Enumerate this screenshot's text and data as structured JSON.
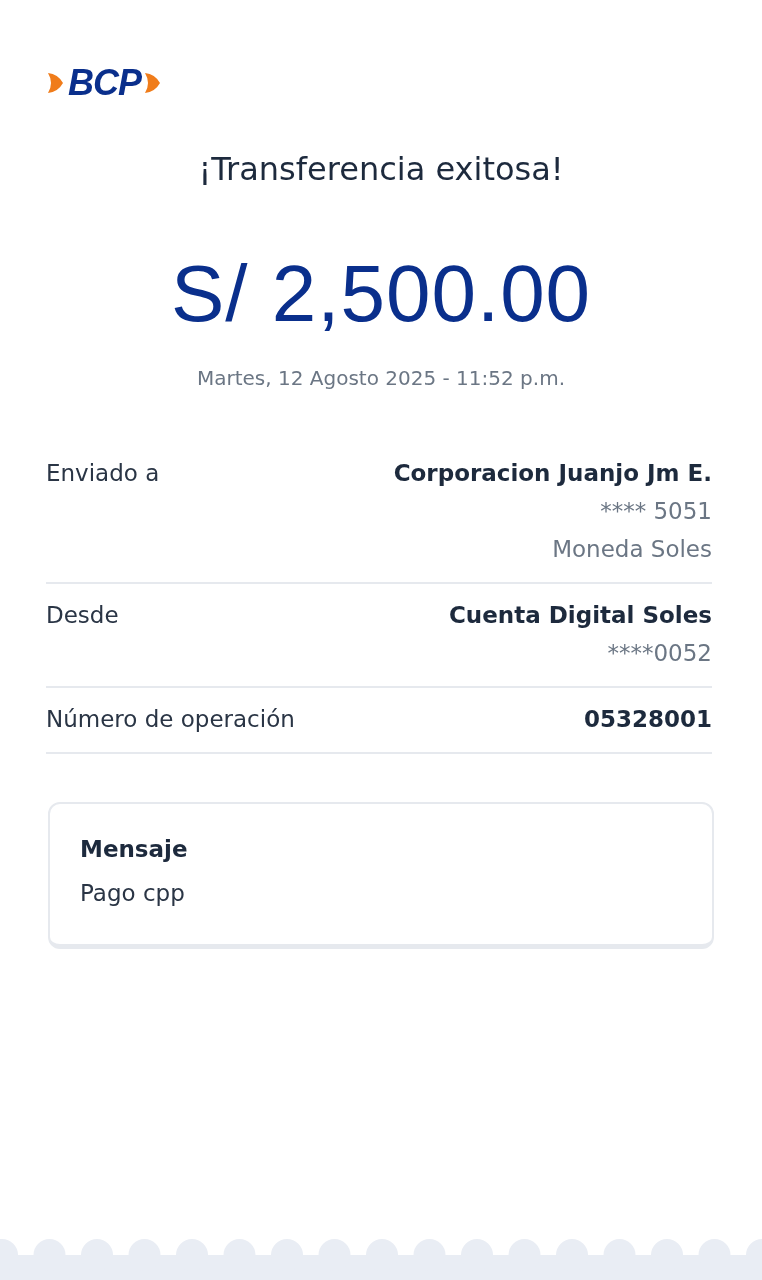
{
  "logo": {
    "text": "BCP"
  },
  "title": "¡Transferencia exitosa!",
  "amount": "S/ 2,500.00",
  "datetime": "Martes, 12 Agosto 2025 - 11:52 p.m.",
  "details": [
    {
      "label": "Enviado a",
      "title": "Corporacion Juanjo Jm E.",
      "lines": [
        "**** 5051",
        "Moneda Soles"
      ]
    },
    {
      "label": "Desde",
      "title": "Cuenta Digital Soles",
      "lines": [
        "****0052"
      ]
    },
    {
      "label": "Número de operación",
      "title": "05328001"
    }
  ],
  "message": {
    "heading": "Mensaje",
    "text": "Pago cpp"
  }
}
